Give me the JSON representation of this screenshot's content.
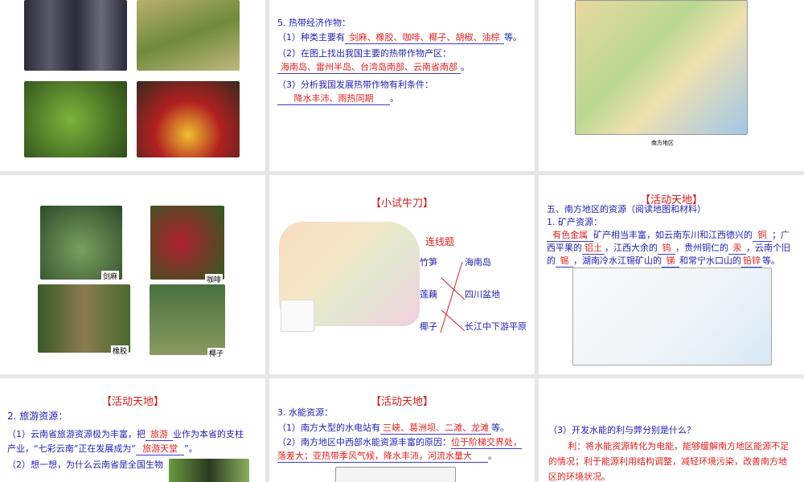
{
  "s2": {
    "heading": "5. 热带经济作物：",
    "q1": "（1）种类主要有",
    "a1": "剑麻、橡胶、咖啡、椰子、胡椒、油棕",
    "end1": "等。",
    "q2": "（2）在图上找出我国主要的热带作物产区：",
    "a2": "海南岛、雷州半岛、台湾岛南部、云南省南部",
    "end2": "。",
    "q3": "（3）分析我国发展热带作物有利条件：",
    "a3": "降水丰沛、雨热同期",
    "end3": "。"
  },
  "s3": {
    "map_caption": "南方地区"
  },
  "s4": {
    "captions": [
      "剑麻",
      "咖啡",
      "橡胶",
      "椰子"
    ]
  },
  "s5": {
    "title": "【小试牛刀】",
    "subtitle": "连线题",
    "left": [
      "竹笋",
      "莲藕",
      "椰子"
    ],
    "right": [
      "海南岛",
      "四川盆地",
      "长江中下游平原"
    ]
  },
  "s6": {
    "title": "【活动天地】",
    "heading": "五、南方地区的资源（阅读地图和材料）",
    "sub": "1. 矿产资源：",
    "a1": "有色金属",
    "t1": "矿产相当丰富，如云南东川和江西德兴的",
    "a2": "铜",
    "t2": "；广",
    "t3": "西平果的",
    "a3": "铝土",
    "t4": "，江西大余的",
    "a4": "钨",
    "t5": "，贵州铜仁的",
    "a5": "汞",
    "t6": "，云南个旧",
    "t7": "的",
    "a6": "锡",
    "t8": "，湖南冷水江锡矿山的",
    "a7": "锑",
    "t9": "和常宁水口山的",
    "a8": "铅锌",
    "t10": "等。"
  },
  "s7": {
    "title": "【活动天地】",
    "heading": "2. 旅游资源：",
    "l1a": "（1）云南省旅游资源极为丰富，把",
    "a1": "旅游",
    "l1b": "业作为本省的支柱",
    "l2a": "产业，“七彩云南”正在发展成为“",
    "a2": "旅游天堂",
    "l2b": "”。",
    "l3": "（2）想一想，为什么云南省是全国生物"
  },
  "s8": {
    "title": "【活动天地】",
    "heading": "3. 水能资源：",
    "q1": "（1）南方大型的水电站有",
    "a1": "三峡、葛洲坝、二滩、龙滩",
    "end1": "等。",
    "q2": "（2）南方地区中西部水能资源丰富的原因：",
    "a2a": "位于阶梯交界处，",
    "a2b": "落差大；亚热带季风气候，降水丰沛，河流水量大",
    "end2": "。"
  },
  "s9": {
    "q3": "（3）开发水能的利与弊分别是什么？",
    "ans": "利：将水能资源转化为电能，能够缓解南方地区能源不足的情况；利于能源利用结构调整，减轻环境污染，改善南方地区的环境状况。"
  }
}
